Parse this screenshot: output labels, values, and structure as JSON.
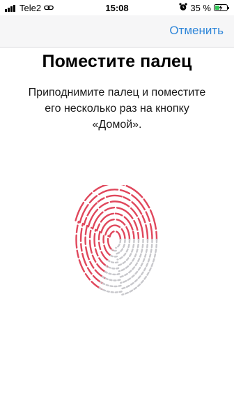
{
  "status_bar": {
    "carrier": "Tele2",
    "time": "15:08",
    "battery_percent": "35 %",
    "battery_level": 0.35,
    "icons": [
      "signal-icon",
      "link-icon",
      "alarm-icon",
      "battery-icon"
    ]
  },
  "nav": {
    "cancel_label": "Отменить"
  },
  "main": {
    "title": "Поместите палец",
    "instruction_lines": [
      "Приподнимите палец и поместите",
      "его несколько раз на кнопку",
      "«Домой»."
    ],
    "fingerprint_icon": "fingerprint-icon"
  },
  "colors": {
    "accent": "#2f86d9",
    "fingerprint_active": "#e0475c",
    "fingerprint_inactive": "#c8c8cc",
    "battery_charge": "#34c759"
  }
}
